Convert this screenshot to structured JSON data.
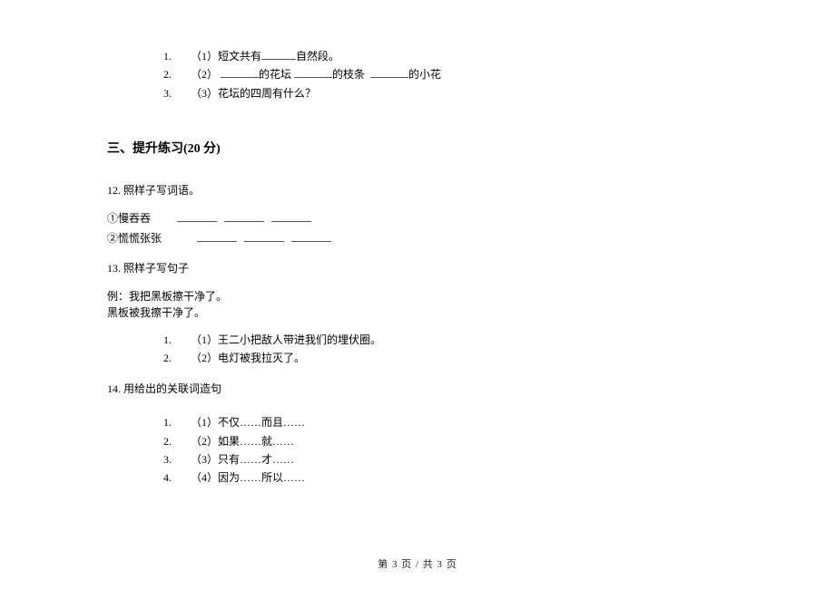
{
  "top_list": {
    "items": [
      {
        "num": "1.",
        "prefix": "（1）短文共有",
        "suffix": "自然段。"
      },
      {
        "num": "2.",
        "parts": [
          "（2）",
          "的花坛",
          "的枝条",
          "的小花"
        ]
      },
      {
        "num": "3.",
        "text": "（3）花坛的四周有什么？"
      }
    ]
  },
  "section_title": "三、提升练习(20 分)",
  "q12": {
    "title": "12.  照样子写词语。",
    "rows": [
      {
        "label": "①慢吞吞"
      },
      {
        "label": "②慌慌张张"
      }
    ]
  },
  "q13": {
    "title": "13.  照样子写句子",
    "example_line1": "例：我把黑板擦干净了。",
    "example_line2": "黑板被我擦干净了。",
    "items": [
      {
        "num": "1.",
        "text": "（1）王二小把敌人带进我们的埋伏圈。"
      },
      {
        "num": "2.",
        "text": "（2）电灯被我拉灭了。"
      }
    ]
  },
  "q14": {
    "title": "14.  用给出的关联词造句",
    "items": [
      {
        "num": "1.",
        "text": "（1）不仅……而且……"
      },
      {
        "num": "2.",
        "text": "（2）如果……就……"
      },
      {
        "num": "3.",
        "text": "（3）只有……才……"
      },
      {
        "num": "4.",
        "text": "（4）因为……所以……"
      }
    ]
  },
  "pager": "第 3 页  /  共 3 页"
}
